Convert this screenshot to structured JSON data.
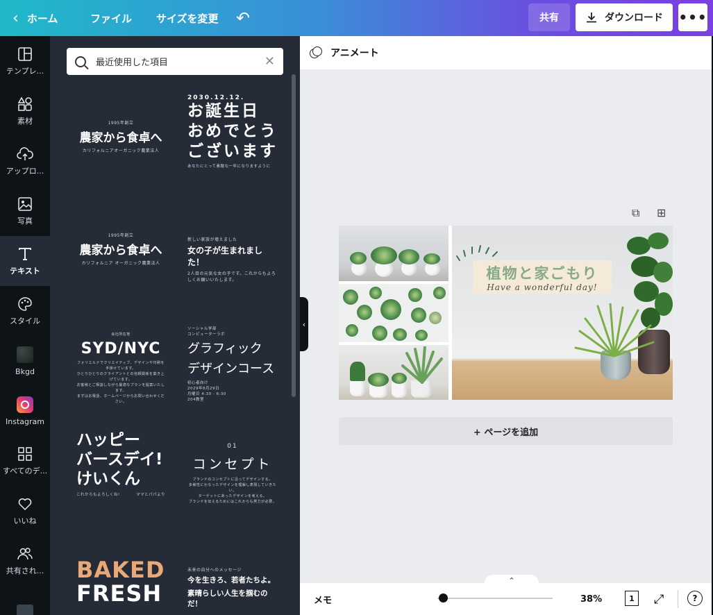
{
  "topbar": {
    "home_label": "ホーム",
    "file_label": "ファイル",
    "resize_label": "サイズを変更",
    "share_label": "共有",
    "download_label": "ダウンロード",
    "more_label": "•••"
  },
  "sidebar": {
    "items": [
      {
        "label": "テンプレ...",
        "icon": "template-icon"
      },
      {
        "label": "素材",
        "icon": "elements-icon"
      },
      {
        "label": "アップロ...",
        "icon": "upload-icon"
      },
      {
        "label": "写真",
        "icon": "photo-icon"
      },
      {
        "label": "テキスト",
        "icon": "text-icon",
        "active": true
      },
      {
        "label": "スタイル",
        "icon": "palette-icon"
      },
      {
        "label": "Bkgd",
        "icon": "background-icon"
      },
      {
        "label": "Instagram",
        "icon": "instagram-icon"
      },
      {
        "label": "すべてのデ...",
        "icon": "apps-grid-icon"
      },
      {
        "label": "いいね",
        "icon": "heart-icon"
      },
      {
        "label": "共有され...",
        "icon": "shared-people-icon"
      }
    ]
  },
  "search": {
    "value": "最近使用した項目"
  },
  "templates": {
    "t1": {
      "small": "1995年創立",
      "title": "農家から食卓へ",
      "sub": "カリフォルニアオーガニック農業法人"
    },
    "t2": {
      "date": "2030.12.12.",
      "line1": "お誕生日",
      "line2": "おめでとう",
      "line3": "ございます",
      "sub": "あなたにとって素敵な一年になりますように"
    },
    "t3": {
      "small": "1995年創立",
      "title": "農家から食卓へ",
      "sub": "カリフォルニア オーガニック農業法人"
    },
    "t4": {
      "small": "新しい家族が増えました",
      "title": "女の子が生まれました！",
      "sub": "2人目の元気な女の子です。これからもよろしくお願いいたします。"
    },
    "t5": {
      "small": "会社所在地",
      "title": "SYD/NYC",
      "sub1": "フォリエルナでクリエイティブ、デザインや印刷を手掛けています。",
      "sub2": "ひとりひとりのクライアントとの信頼関係を築き上げています。",
      "sub3": "お客様とご相談しながら最適なプランを提案いたします。",
      "sub4": "まずはお電話、ホームページからお問い合わせください。"
    },
    "t6": {
      "small1": "ソーシャル学部",
      "small2": "コンピューターラボ",
      "line1": "グラフィック",
      "line2": "デザインコース",
      "sub1": "初心者向け",
      "sub2": "2029年8月29日",
      "sub3": "月曜日 4:30 - 6:30",
      "sub4": "204教室"
    },
    "t7": {
      "line1": "ハッピー",
      "line2": "バースデイ!",
      "line3": "けいくん",
      "sub": "これからもよろしくね!",
      "sign": "ママとパパより"
    },
    "t8": {
      "num": "01",
      "title": "コンセプト",
      "sub1": "ブランドのコンセプトに沿ってデザインする。",
      "sub2": "多様性にかなったデザインを理解し表現していきたい。",
      "sub3": "ターゲットにあったデザインを考える。",
      "sub4": "ブランドを伝えるためにはこれからも努力が必要。"
    },
    "t9": {
      "line1": "BAKED",
      "line2": "FRESH"
    },
    "t10": {
      "small": "未来の自分へのメッセージ",
      "line1": "今を生きろ、若者たちよ。",
      "line2": "素晴らしい人生を掴むのだ！"
    }
  },
  "editor": {
    "animate_label": "アニメート",
    "design_title": "植物と家ごもり",
    "design_subtitle": "Have a wonderful day!",
    "add_page_label": "+ ページを追加",
    "memo_label": "メモ",
    "zoom_label": "38%",
    "page_count": "1",
    "help_label": "?"
  },
  "colors": {
    "topbar_gradient": [
      "#1fb9c9",
      "#7b3fe4"
    ],
    "panel_bg": "#252c37",
    "nav_bg": "#0e1318",
    "canvas_bg": "#ebecf0",
    "title_green": "#86a98a",
    "baked_orange": "#e8a877"
  }
}
